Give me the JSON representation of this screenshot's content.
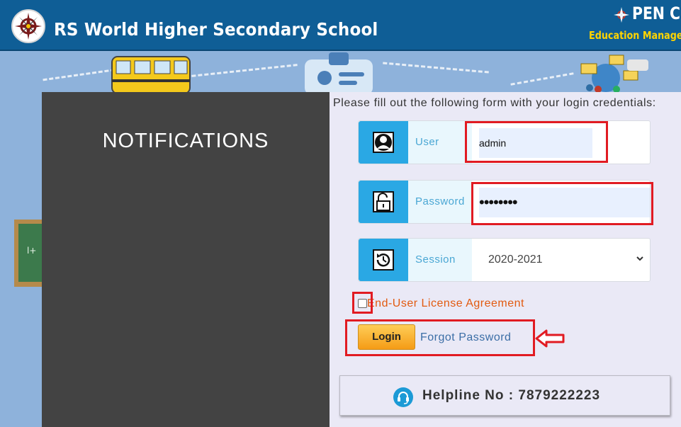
{
  "header": {
    "school_name": "RS World Higher Secondary School",
    "brand_name": "PEN CO",
    "brand_tagline": "Education Management"
  },
  "notifications": {
    "title": "NOTIFICATIONS"
  },
  "login_form": {
    "instructions": "Please fill out the following form with your login credentials:",
    "user": {
      "label": "User",
      "value": "admin",
      "icon": "user-icon"
    },
    "password": {
      "label": "Password",
      "value": "••••••••",
      "icon": "unlock-icon"
    },
    "session": {
      "label": "Session",
      "selected": "2020-2021",
      "icon": "history-clock-icon"
    },
    "eula_label": "End-User License Agreement",
    "eula_checked": false,
    "login_button": "Login",
    "forgot_password": "Forgot Password"
  },
  "helpline": {
    "text": "Helpline No : 7879222223",
    "icon": "headset-icon"
  },
  "colors": {
    "header_bg": "#0f5e96",
    "brand_yellow": "#ffd400",
    "field_icon_bg": "#2aa8e4",
    "highlight_red": "#e11b22",
    "eula_orange": "#e25a10",
    "login_button": "#f5a623"
  }
}
